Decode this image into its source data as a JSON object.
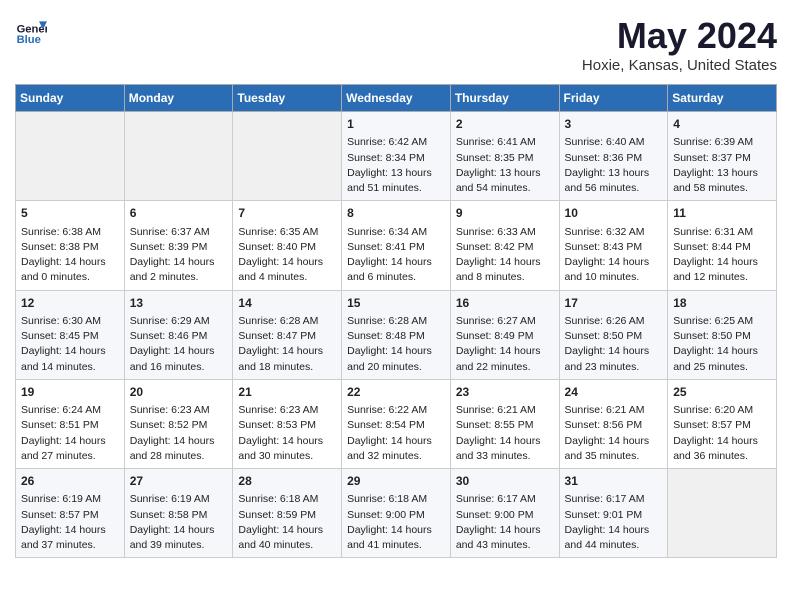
{
  "header": {
    "logo_line1": "General",
    "logo_line2": "Blue",
    "title": "May 2024",
    "location": "Hoxie, Kansas, United States"
  },
  "days_of_week": [
    "Sunday",
    "Monday",
    "Tuesday",
    "Wednesday",
    "Thursday",
    "Friday",
    "Saturday"
  ],
  "weeks": [
    [
      {
        "day": "",
        "empty": true
      },
      {
        "day": "",
        "empty": true
      },
      {
        "day": "",
        "empty": true
      },
      {
        "day": "1",
        "sunrise": "Sunrise: 6:42 AM",
        "sunset": "Sunset: 8:34 PM",
        "daylight": "Daylight: 13 hours and 51 minutes."
      },
      {
        "day": "2",
        "sunrise": "Sunrise: 6:41 AM",
        "sunset": "Sunset: 8:35 PM",
        "daylight": "Daylight: 13 hours and 54 minutes."
      },
      {
        "day": "3",
        "sunrise": "Sunrise: 6:40 AM",
        "sunset": "Sunset: 8:36 PM",
        "daylight": "Daylight: 13 hours and 56 minutes."
      },
      {
        "day": "4",
        "sunrise": "Sunrise: 6:39 AM",
        "sunset": "Sunset: 8:37 PM",
        "daylight": "Daylight: 13 hours and 58 minutes."
      }
    ],
    [
      {
        "day": "5",
        "sunrise": "Sunrise: 6:38 AM",
        "sunset": "Sunset: 8:38 PM",
        "daylight": "Daylight: 14 hours and 0 minutes."
      },
      {
        "day": "6",
        "sunrise": "Sunrise: 6:37 AM",
        "sunset": "Sunset: 8:39 PM",
        "daylight": "Daylight: 14 hours and 2 minutes."
      },
      {
        "day": "7",
        "sunrise": "Sunrise: 6:35 AM",
        "sunset": "Sunset: 8:40 PM",
        "daylight": "Daylight: 14 hours and 4 minutes."
      },
      {
        "day": "8",
        "sunrise": "Sunrise: 6:34 AM",
        "sunset": "Sunset: 8:41 PM",
        "daylight": "Daylight: 14 hours and 6 minutes."
      },
      {
        "day": "9",
        "sunrise": "Sunrise: 6:33 AM",
        "sunset": "Sunset: 8:42 PM",
        "daylight": "Daylight: 14 hours and 8 minutes."
      },
      {
        "day": "10",
        "sunrise": "Sunrise: 6:32 AM",
        "sunset": "Sunset: 8:43 PM",
        "daylight": "Daylight: 14 hours and 10 minutes."
      },
      {
        "day": "11",
        "sunrise": "Sunrise: 6:31 AM",
        "sunset": "Sunset: 8:44 PM",
        "daylight": "Daylight: 14 hours and 12 minutes."
      }
    ],
    [
      {
        "day": "12",
        "sunrise": "Sunrise: 6:30 AM",
        "sunset": "Sunset: 8:45 PM",
        "daylight": "Daylight: 14 hours and 14 minutes."
      },
      {
        "day": "13",
        "sunrise": "Sunrise: 6:29 AM",
        "sunset": "Sunset: 8:46 PM",
        "daylight": "Daylight: 14 hours and 16 minutes."
      },
      {
        "day": "14",
        "sunrise": "Sunrise: 6:28 AM",
        "sunset": "Sunset: 8:47 PM",
        "daylight": "Daylight: 14 hours and 18 minutes."
      },
      {
        "day": "15",
        "sunrise": "Sunrise: 6:28 AM",
        "sunset": "Sunset: 8:48 PM",
        "daylight": "Daylight: 14 hours and 20 minutes."
      },
      {
        "day": "16",
        "sunrise": "Sunrise: 6:27 AM",
        "sunset": "Sunset: 8:49 PM",
        "daylight": "Daylight: 14 hours and 22 minutes."
      },
      {
        "day": "17",
        "sunrise": "Sunrise: 6:26 AM",
        "sunset": "Sunset: 8:50 PM",
        "daylight": "Daylight: 14 hours and 23 minutes."
      },
      {
        "day": "18",
        "sunrise": "Sunrise: 6:25 AM",
        "sunset": "Sunset: 8:50 PM",
        "daylight": "Daylight: 14 hours and 25 minutes."
      }
    ],
    [
      {
        "day": "19",
        "sunrise": "Sunrise: 6:24 AM",
        "sunset": "Sunset: 8:51 PM",
        "daylight": "Daylight: 14 hours and 27 minutes."
      },
      {
        "day": "20",
        "sunrise": "Sunrise: 6:23 AM",
        "sunset": "Sunset: 8:52 PM",
        "daylight": "Daylight: 14 hours and 28 minutes."
      },
      {
        "day": "21",
        "sunrise": "Sunrise: 6:23 AM",
        "sunset": "Sunset: 8:53 PM",
        "daylight": "Daylight: 14 hours and 30 minutes."
      },
      {
        "day": "22",
        "sunrise": "Sunrise: 6:22 AM",
        "sunset": "Sunset: 8:54 PM",
        "daylight": "Daylight: 14 hours and 32 minutes."
      },
      {
        "day": "23",
        "sunrise": "Sunrise: 6:21 AM",
        "sunset": "Sunset: 8:55 PM",
        "daylight": "Daylight: 14 hours and 33 minutes."
      },
      {
        "day": "24",
        "sunrise": "Sunrise: 6:21 AM",
        "sunset": "Sunset: 8:56 PM",
        "daylight": "Daylight: 14 hours and 35 minutes."
      },
      {
        "day": "25",
        "sunrise": "Sunrise: 6:20 AM",
        "sunset": "Sunset: 8:57 PM",
        "daylight": "Daylight: 14 hours and 36 minutes."
      }
    ],
    [
      {
        "day": "26",
        "sunrise": "Sunrise: 6:19 AM",
        "sunset": "Sunset: 8:57 PM",
        "daylight": "Daylight: 14 hours and 37 minutes."
      },
      {
        "day": "27",
        "sunrise": "Sunrise: 6:19 AM",
        "sunset": "Sunset: 8:58 PM",
        "daylight": "Daylight: 14 hours and 39 minutes."
      },
      {
        "day": "28",
        "sunrise": "Sunrise: 6:18 AM",
        "sunset": "Sunset: 8:59 PM",
        "daylight": "Daylight: 14 hours and 40 minutes."
      },
      {
        "day": "29",
        "sunrise": "Sunrise: 6:18 AM",
        "sunset": "Sunset: 9:00 PM",
        "daylight": "Daylight: 14 hours and 41 minutes."
      },
      {
        "day": "30",
        "sunrise": "Sunrise: 6:17 AM",
        "sunset": "Sunset: 9:00 PM",
        "daylight": "Daylight: 14 hours and 43 minutes."
      },
      {
        "day": "31",
        "sunrise": "Sunrise: 6:17 AM",
        "sunset": "Sunset: 9:01 PM",
        "daylight": "Daylight: 14 hours and 44 minutes."
      },
      {
        "day": "",
        "empty": true
      }
    ]
  ]
}
